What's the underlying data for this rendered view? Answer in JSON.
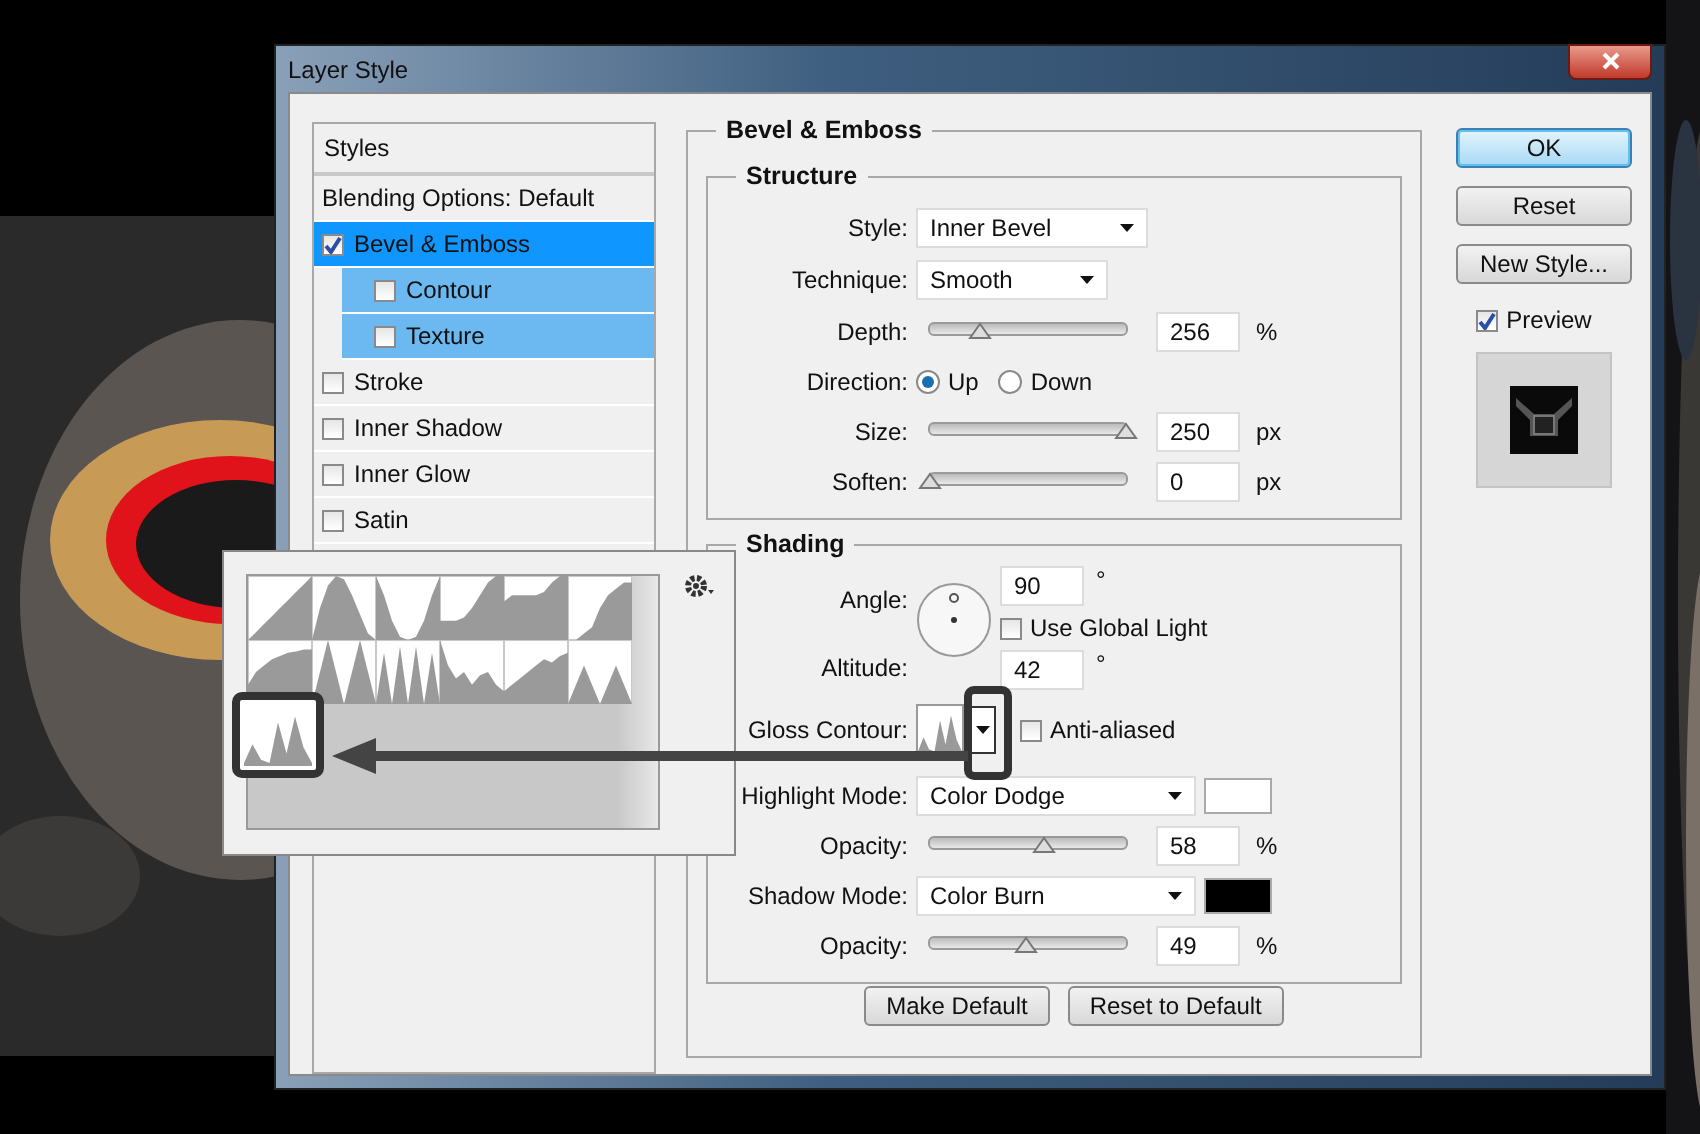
{
  "window": {
    "title": "Layer Style"
  },
  "styles_panel": {
    "header": "Styles",
    "items": [
      {
        "kind": "plain",
        "label": "Blending Options: Default",
        "selected": false
      },
      {
        "kind": "check",
        "label": "Bevel & Emboss",
        "checked": true,
        "selected": true,
        "children": [
          {
            "kind": "check",
            "label": "Contour",
            "checked": false,
            "selected": false
          },
          {
            "kind": "check",
            "label": "Texture",
            "checked": false,
            "selected": false
          }
        ]
      },
      {
        "kind": "check",
        "label": "Stroke",
        "checked": false,
        "selected": false
      },
      {
        "kind": "check",
        "label": "Inner Shadow",
        "checked": false,
        "selected": false
      },
      {
        "kind": "check",
        "label": "Inner Glow",
        "checked": false,
        "selected": false
      },
      {
        "kind": "check",
        "label": "Satin",
        "checked": false,
        "selected": false
      }
    ]
  },
  "bevel_emboss": {
    "title": "Bevel & Emboss",
    "structure": {
      "title": "Structure",
      "rows": [
        {
          "kind": "select",
          "label": "Style:",
          "value": "Inner Bevel"
        },
        {
          "kind": "select",
          "label": "Technique:",
          "value": "Smooth"
        },
        {
          "kind": "slider",
          "label": "Depth:",
          "level": 0.26,
          "value": "256",
          "unit": "%"
        },
        {
          "kind": "radio",
          "label": "Direction:",
          "options": [
            {
              "label": "Up",
              "selected": true
            },
            {
              "label": "Down",
              "selected": false
            }
          ]
        },
        {
          "kind": "slider",
          "label": "Size:",
          "level": 1.0,
          "value": "250",
          "unit": "px"
        },
        {
          "kind": "slider",
          "label": "Soften:",
          "level": 0.0,
          "value": "0",
          "unit": "px"
        }
      ]
    },
    "shading": {
      "title": "Shading",
      "angle": {
        "label": "Angle:",
        "value": "90",
        "unit": "°"
      },
      "global_light": {
        "label": "Use Global Light",
        "checked": false
      },
      "altitude": {
        "label": "Altitude:",
        "value": "42",
        "unit": "°"
      },
      "gloss_contour": {
        "label": "Gloss Contour:"
      },
      "anti_aliased": {
        "label": "Anti-aliased",
        "checked": false
      },
      "rows": [
        {
          "kind": "mode",
          "label": "Highlight Mode:",
          "value": "Color Dodge",
          "color": "#ffffff"
        },
        {
          "kind": "slider",
          "label": "Opacity:",
          "level": 0.58,
          "value": "58",
          "unit": "%"
        },
        {
          "kind": "mode",
          "label": "Shadow Mode:",
          "value": "Color Burn",
          "color": "#000000"
        },
        {
          "kind": "slider",
          "label": "Opacity:",
          "level": 0.49,
          "value": "49",
          "unit": "%"
        }
      ]
    },
    "buttons": [
      "Make Default",
      "Reset to Default"
    ]
  },
  "actions": [
    {
      "label": "OK",
      "default": true
    },
    {
      "label": "Reset",
      "default": false
    },
    {
      "label": "New Style...",
      "default": false
    }
  ],
  "preview": {
    "label": "Preview",
    "checked": true
  }
}
